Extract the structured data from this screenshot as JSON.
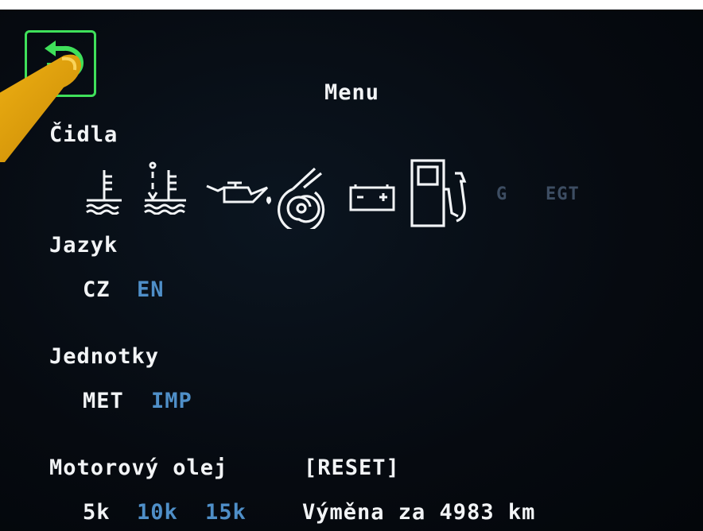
{
  "header": {
    "title": "Menu",
    "back_icon": "back-arrow-icon"
  },
  "sensors": {
    "label": "Čidla",
    "icons": [
      "coolant-temp-icon",
      "coolant-level-temp-icon",
      "oil-can-icon",
      "turbo-icon",
      "battery-icon",
      "fuel-pump-icon"
    ],
    "extra": [
      "G",
      "EGT"
    ]
  },
  "language": {
    "label": "Jazyk",
    "options": [
      "CZ",
      "EN"
    ],
    "selected": "CZ"
  },
  "units": {
    "label": "Jednotky",
    "options": [
      "MET",
      "IMP"
    ],
    "selected": "MET"
  },
  "oil": {
    "label": "Motorový olej",
    "reset": "[RESET]",
    "intervals": [
      "5k",
      "10k",
      "15k"
    ],
    "selected": "5k",
    "change_text": "Výměna za 4983 km"
  },
  "colors": {
    "active": "#f2f4f6",
    "inactive": "#4f8fc8",
    "accent": "#3fe05a",
    "disabled": "#3d4d62"
  }
}
